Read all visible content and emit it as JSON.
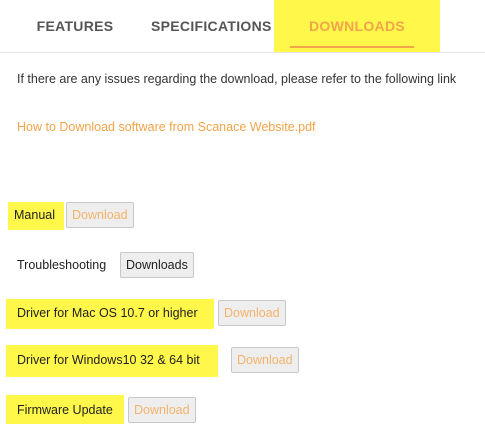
{
  "tabs": [
    {
      "label": "FEATURES"
    },
    {
      "label": "SPECIFICATIONS"
    },
    {
      "label": "DOWNLOADS",
      "active": true
    }
  ],
  "intro_text": "If there are any issues regarding the download, please refer to the following link",
  "help_link": "How to Download software from Scanace Website.pdf",
  "downloads": [
    {
      "label": "Manual",
      "button": "Download",
      "highlighted": true
    },
    {
      "label": "Troubleshooting",
      "button": "Downloads",
      "highlighted": false
    },
    {
      "label": "Driver for Mac OS 10.7 or higher",
      "button": "Download",
      "highlighted": true
    },
    {
      "label": "Driver for Windows10 32 & 64 bit",
      "button": "Download",
      "highlighted": true
    },
    {
      "label": "Firmware Update",
      "button": "Download",
      "highlighted": true
    }
  ],
  "colors": {
    "accent": "#f2a44a",
    "highlight": "#fff84a"
  }
}
